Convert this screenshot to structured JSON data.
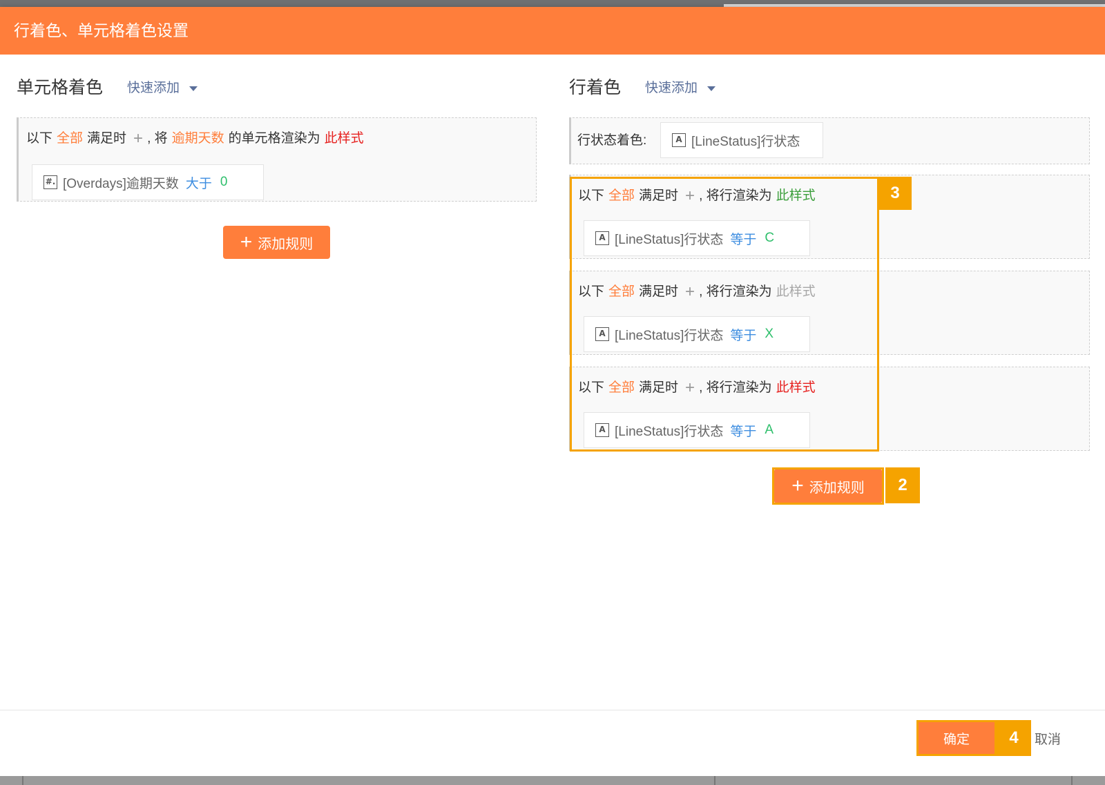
{
  "dialog": {
    "title": "行着色、单元格着色设置"
  },
  "cell_color": {
    "title": "单元格着色",
    "quick_add": "快速添加",
    "rule": {
      "prefix": "以下",
      "scope": "全部",
      "when": "满足时",
      "plus": "+",
      "comma_will": ", 将",
      "field_name": "逾期天数",
      "render_text": "的单元格渲染为",
      "style_link": "此样式",
      "condition": {
        "icon": "#.",
        "field": "[Overdays]逾期天数",
        "operator": "大于",
        "value": "0"
      }
    },
    "add_rule": "添加规则"
  },
  "row_color": {
    "title": "行着色",
    "quick_add": "快速添加",
    "status_label": "行状态着色:",
    "status_field": {
      "icon": "A",
      "field": "[LineStatus]行状态"
    },
    "rules": [
      {
        "prefix": "以下",
        "scope": "全部",
        "when": "满足时",
        "plus": "+",
        "render_text": ", 将行渲染为",
        "style_link": "此样式",
        "style_color": "#3a9e3a",
        "condition": {
          "icon": "A",
          "field": "[LineStatus]行状态",
          "operator": "等于",
          "value": "C"
        }
      },
      {
        "prefix": "以下",
        "scope": "全部",
        "when": "满足时",
        "plus": "+",
        "render_text": ", 将行渲染为",
        "style_link": "此样式",
        "style_color": "#a6a6a6",
        "condition": {
          "icon": "A",
          "field": "[LineStatus]行状态",
          "operator": "等于",
          "value": "X"
        }
      },
      {
        "prefix": "以下",
        "scope": "全部",
        "when": "满足时",
        "plus": "+",
        "render_text": ", 将行渲染为",
        "style_link": "此样式",
        "style_color": "#e6211f",
        "condition": {
          "icon": "A",
          "field": "[LineStatus]行状态",
          "operator": "等于",
          "value": "A"
        }
      }
    ],
    "add_rule": "添加规则"
  },
  "annotations": {
    "rules_badge": "3",
    "add_rule_badge": "2",
    "ok_badge": "4"
  },
  "footer": {
    "ok": "确定",
    "cancel": "取消"
  },
  "colors": {
    "accent": "#ff7e3b",
    "highlight": "#f5a300"
  }
}
